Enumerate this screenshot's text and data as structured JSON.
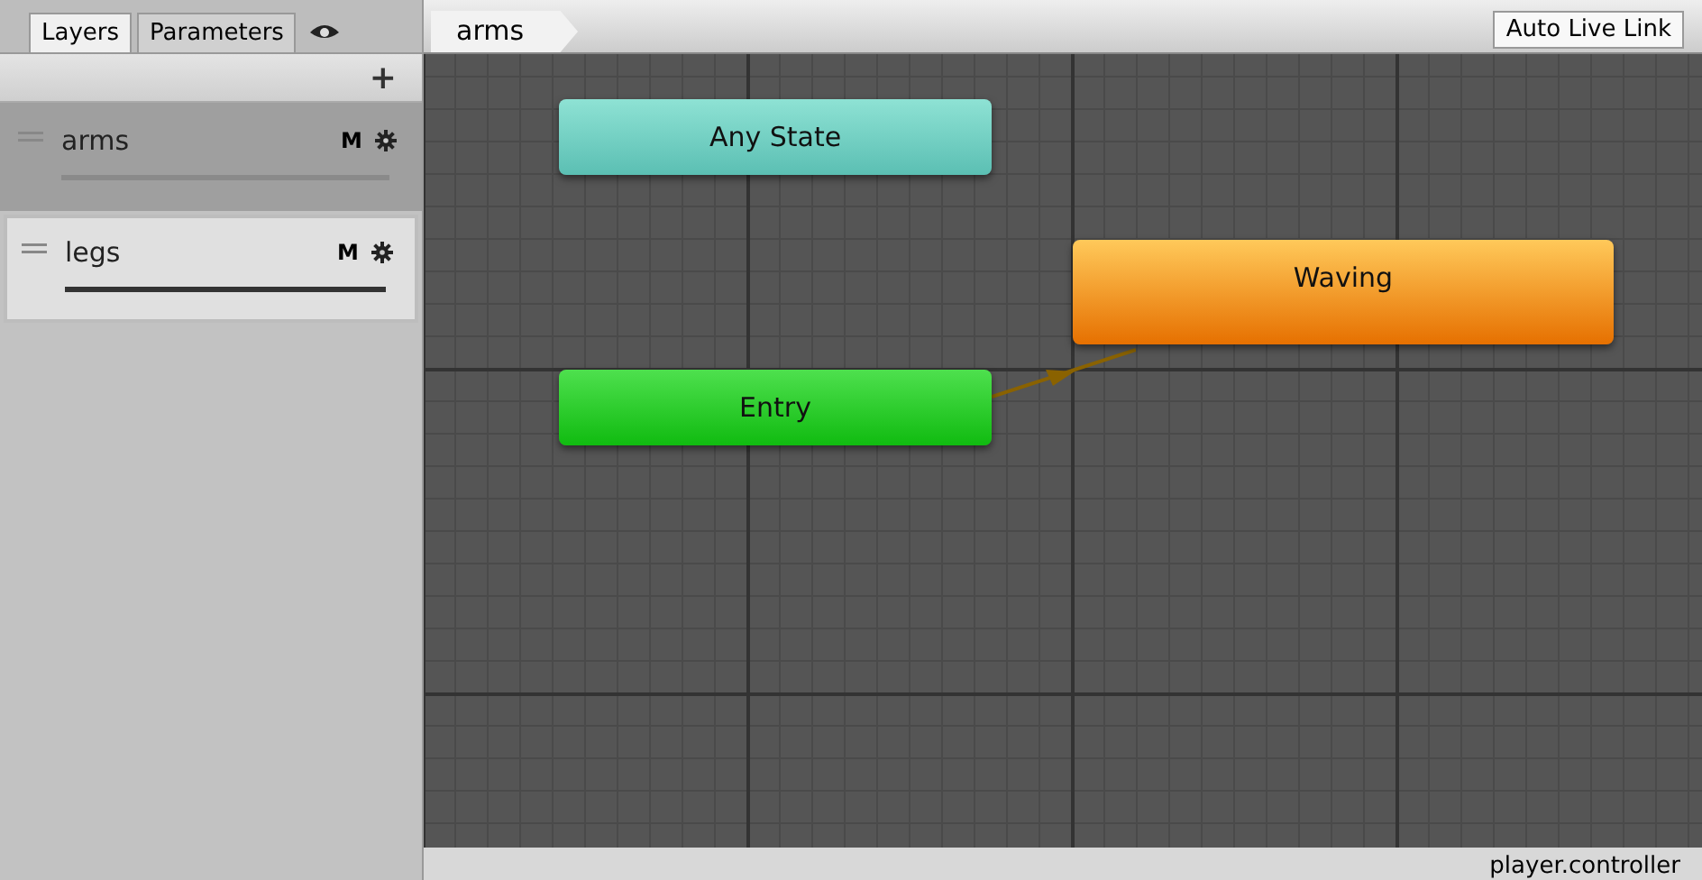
{
  "tabs": [
    {
      "label": "Layers",
      "selected": true
    },
    {
      "label": "Parameters",
      "selected": false
    }
  ],
  "add_button": "+",
  "layers": [
    {
      "name": "arms",
      "selected": true,
      "mute": "M"
    },
    {
      "name": "legs",
      "selected": false,
      "mute": "M"
    }
  ],
  "breadcrumb": "arms",
  "live_link_button": "Auto Live Link",
  "nodes": [
    {
      "label": "Any State",
      "kind": "any"
    },
    {
      "label": "Entry",
      "kind": "entry"
    },
    {
      "label": "Waving",
      "kind": "default"
    }
  ],
  "status_bar": "player.controller"
}
